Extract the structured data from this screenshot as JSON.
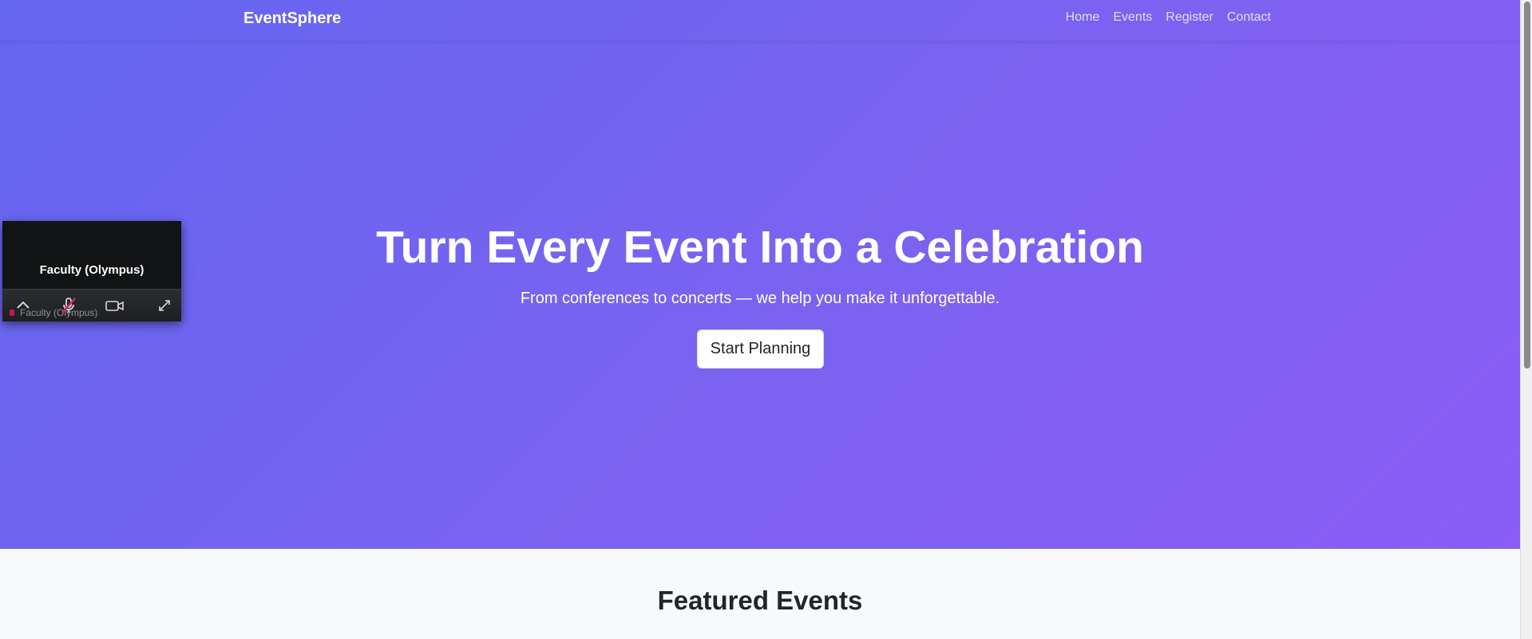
{
  "navbar": {
    "brand": "EventSphere",
    "links": [
      "Home",
      "Events",
      "Register",
      "Contact"
    ]
  },
  "hero": {
    "title": "Turn Every Event Into a Celebration",
    "subtitle": "From conferences to concerts — we help you make it unforgettable.",
    "cta_label": "Start Planning"
  },
  "featured": {
    "title": "Featured Events"
  },
  "video_call": {
    "participant_name": "Faculty (Olympus)",
    "toolbar_caption": "Faculty (Olympus)",
    "icons": [
      "chevron-up-icon",
      "microphone-muted-icon",
      "camera-icon",
      "expand-icon"
    ]
  },
  "colors": {
    "hero_gradient_start": "#6366f1",
    "hero_gradient_end": "#8b5cf6",
    "section_background": "#f8f9fa",
    "muted_mic": "#c2185b"
  }
}
